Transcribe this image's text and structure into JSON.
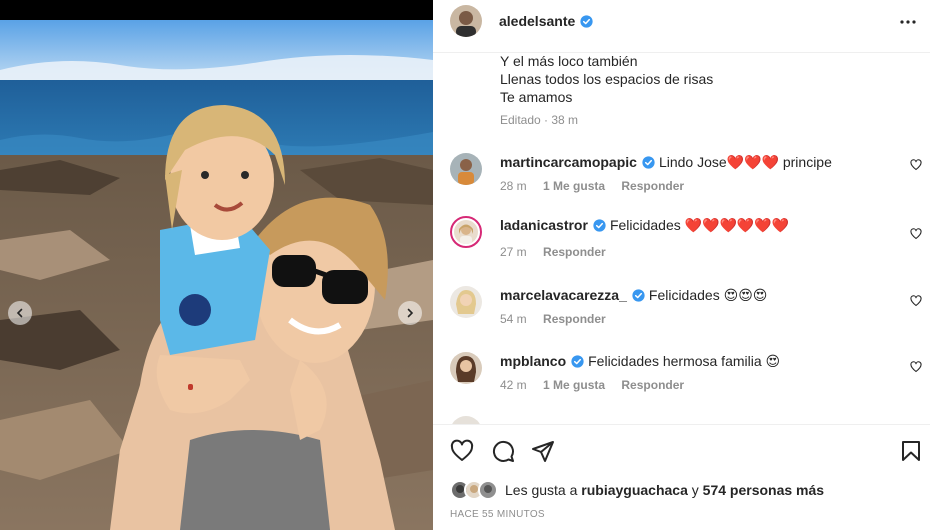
{
  "post": {
    "username": "aledelsante",
    "caption_lines": [
      "Y el más loco también",
      "Llenas todos los espacios de risas",
      "Te amamos"
    ],
    "caption_meta": "Editado · 38 m",
    "timestamp": "HACE 55 MINUTOS"
  },
  "comments": [
    {
      "username": "martincarcamopapic",
      "text": "Lindo Jose❤️❤️❤️ principe",
      "time": "28 m",
      "likes": "1 Me gusta",
      "reply": "Responder"
    },
    {
      "username": "ladanicastror",
      "text": "Felicidades ❤️❤️❤️❤️❤️❤️",
      "time": "27 m",
      "reply": "Responder"
    },
    {
      "username": "marcelavacarezza_",
      "text": "Felicidades 😍😍😍",
      "time": "54 m",
      "reply": "Responder"
    },
    {
      "username": "mpblanco",
      "text": "Felicidades hermosa familia 😍",
      "time": "42 m",
      "likes": "1 Me gusta",
      "reply": "Responder"
    }
  ],
  "likes": {
    "prefix": "Les gusta a",
    "user": "rubiayguachaca",
    "joiner": "y",
    "others": "574 personas más"
  },
  "icons": {
    "verified": "verified-badge-icon",
    "more": "more-options-icon",
    "like": "heart-icon",
    "comment": "comment-icon",
    "share": "send-icon",
    "save": "bookmark-icon"
  },
  "colors": {
    "verified_blue": "#3897f0",
    "text_primary": "#262626",
    "text_secondary": "#8e8e8e",
    "story_ring": "#d62976"
  }
}
